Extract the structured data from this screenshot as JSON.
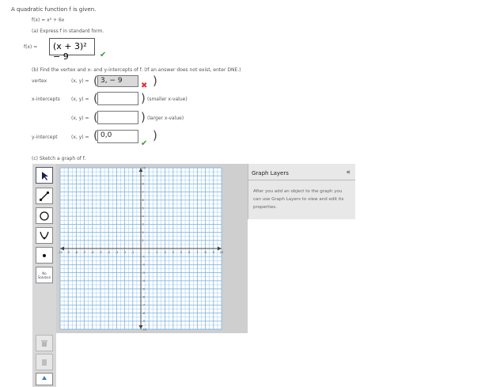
{
  "intro": "A quadratic function f is given.",
  "function_def": "f(x) = x² + 6x",
  "part_a": {
    "prompt": "(a) Express f in standard form.",
    "lhs": "f(x) =",
    "answer": "(x + 3)² − 9",
    "status": "correct"
  },
  "part_b": {
    "prompt": "(b) Find the vertex and x- and y-intercepts of f. (If an answer does not exist, enter DNE.)",
    "vertex_label": "vertex",
    "xy_label": "(x, y) =",
    "vertex_value": "3, − 9",
    "vertex_status": "incorrect",
    "xint_label": "x-intercepts",
    "xint1_value": "",
    "xint1_hint": "(smaller x-value)",
    "xint2_value": "",
    "xint2_hint": "(larger x-value)",
    "yint_label": "y-intercept",
    "yint_value": "0,0",
    "yint_status": "correct"
  },
  "part_c": {
    "prompt": "(c) Sketch a graph of f."
  },
  "toolbar": {
    "tools": [
      "pointer-icon",
      "line-segment-icon",
      "circle-icon",
      "parabola-icon",
      "point-icon"
    ],
    "no_solution_label": "No\nSolution"
  },
  "graph": {
    "xmin": -10,
    "xmax": 10,
    "ymin": -10,
    "ymax": 10,
    "x_tick_labels": [
      "-10",
      "-9",
      "-8",
      "-7",
      "-6",
      "-5",
      "-4",
      "-3",
      "-2",
      "-1",
      "1",
      "2",
      "3",
      "4",
      "5",
      "6",
      "7",
      "8",
      "9",
      "10"
    ],
    "y_tick_labels": [
      "10",
      "9",
      "8",
      "7",
      "6",
      "5",
      "4",
      "3",
      "2",
      "1",
      "-1",
      "-2",
      "-3",
      "-4",
      "-5",
      "-6",
      "-7",
      "-8",
      "-9",
      "-10"
    ],
    "grid_color": "#86b9e3",
    "axis_color": "#444444"
  },
  "layers_panel": {
    "title": "Graph Layers",
    "collapse": "«",
    "body": "After you add an object to the graph you can use Graph Layers to view and edit its properties."
  },
  "colors": {
    "check": "#3a9a3a",
    "cross": "#dd3333",
    "panel": "#d7d7d7"
  }
}
